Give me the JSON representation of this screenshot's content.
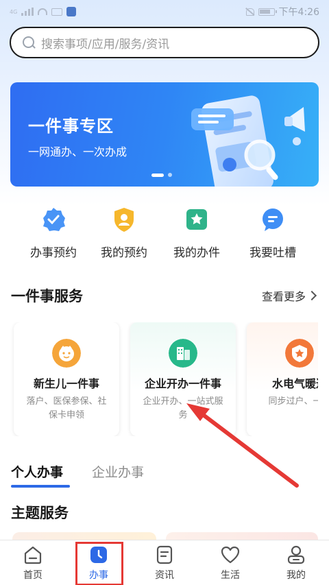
{
  "status_bar": {
    "network": "4G",
    "time": "下午4:26"
  },
  "search": {
    "placeholder": "搜索事项/应用/服务/资讯"
  },
  "banner": {
    "title": "一件事专区",
    "subtitle": "一网通办、一次办成"
  },
  "quick_actions": [
    {
      "label": "办事预约",
      "icon": "badge-check-icon",
      "color": "#3f8ef5"
    },
    {
      "label": "我的预约",
      "icon": "user-shield-icon",
      "color": "#f6b72c"
    },
    {
      "label": "我的办件",
      "icon": "star-folder-icon",
      "color": "#2fb38a"
    },
    {
      "label": "我要吐槽",
      "icon": "chat-bubble-icon",
      "color": "#3f8ef5"
    }
  ],
  "services_section": {
    "title": "一件事服务",
    "more": "查看更多"
  },
  "service_cards": [
    {
      "title": "新生儿一件事",
      "desc": "落户、医保参保、社保卡申领",
      "icon": "baby-icon",
      "color": "#f5a53a"
    },
    {
      "title": "企业开办一件事",
      "desc": "企业开办、一站式服务",
      "icon": "building-icon",
      "color": "#27b88a"
    },
    {
      "title": "水电气暖过",
      "desc": "同步过户、一成",
      "icon": "house-star-icon",
      "color": "#f2783a"
    }
  ],
  "tabs": {
    "personal": "个人办事",
    "enterprise": "企业办事"
  },
  "theme_section": {
    "title": "主题服务"
  },
  "bottom_nav": [
    {
      "label": "首页",
      "icon": "home-icon"
    },
    {
      "label": "办事",
      "icon": "clock-icon"
    },
    {
      "label": "资讯",
      "icon": "news-icon"
    },
    {
      "label": "生活",
      "icon": "heart-icon"
    },
    {
      "label": "我的",
      "icon": "profile-icon"
    }
  ],
  "colors": {
    "accent": "#2d69e6",
    "highlight_red": "#e53935"
  }
}
